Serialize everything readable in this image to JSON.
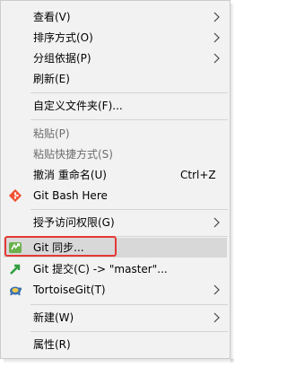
{
  "menu": {
    "items": [
      {
        "label": "查看(V)",
        "submenu": true
      },
      {
        "label": "排序方式(O)",
        "submenu": true
      },
      {
        "label": "分组依据(P)",
        "submenu": true
      },
      {
        "label": "刷新(E)"
      },
      {
        "label": "自定义文件夹(F)..."
      },
      {
        "label": "粘贴(P)",
        "disabled": true
      },
      {
        "label": "粘贴快捷方式(S)",
        "disabled": true
      },
      {
        "label": "撤消 重命名(U)",
        "shortcut": "Ctrl+Z"
      },
      {
        "label": "Git Bash Here",
        "icon": "git-bash-icon"
      },
      {
        "label": "授予访问权限(G)",
        "submenu": true
      },
      {
        "label": "Git 同步...",
        "icon": "git-sync-icon",
        "highlighted": true
      },
      {
        "label": "Git 提交(C) -> \"master\"...",
        "icon": "git-commit-icon"
      },
      {
        "label": "TortoiseGit(T)",
        "icon": "tortoisegit-icon",
        "submenu": true
      },
      {
        "label": "新建(W)",
        "submenu": true
      },
      {
        "label": "属性(R)"
      }
    ]
  },
  "colors": {
    "menu_bg": "#f2f2f2",
    "hover_bg": "#d8d8d8",
    "disabled_text": "#6d6d6d",
    "annotation_red": "#e53935"
  }
}
